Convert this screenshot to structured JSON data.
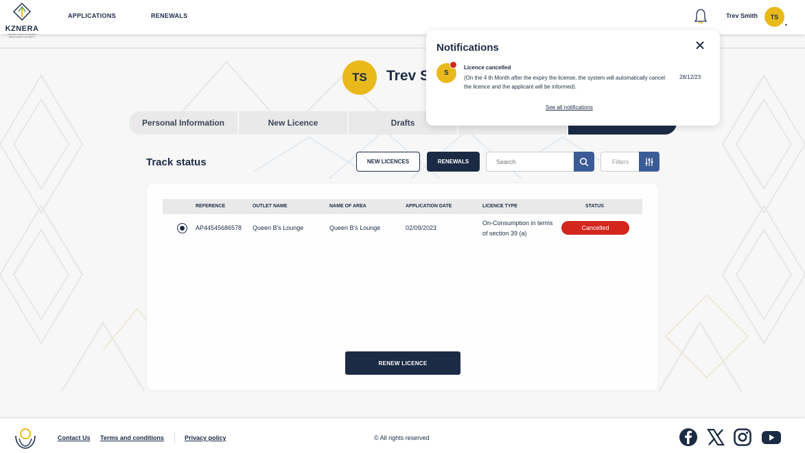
{
  "header": {
    "logo_text": "KZNERA",
    "logo_subtext": "KWAZULU-NATAL ECONOMIC REGULATORY AUTHORITY",
    "nav": [
      "APPLICATIONS",
      "RENEWALS"
    ],
    "user_name": "Trev Smith",
    "user_initials": "TS",
    "icons": {
      "notifications": "bell-icon",
      "menu": "chevron-down-icon"
    }
  },
  "profile": {
    "initials": "TS",
    "name": "Trev Smith"
  },
  "tabs": [
    {
      "label": "Personal Information"
    },
    {
      "label": "New Licence"
    },
    {
      "label": "Drafts"
    },
    {
      "label": ""
    },
    {
      "label": ""
    }
  ],
  "track": {
    "title": "Track status",
    "new_licences_label": "NEW LICENCES",
    "renewals_label": "RENEWALS",
    "search_placeholder": "Search",
    "filters_label": "Filters"
  },
  "table": {
    "headers": [
      "REFERENCE",
      "OUTLET NAME",
      "NAME OF AREA",
      "APPLICATION DATE",
      "LICENCE TYPE",
      "STATUS"
    ],
    "rows": [
      {
        "selected": true,
        "reference": "AP44545686578",
        "outlet_name": "Queen B's Lounge",
        "area": "Queen B's Lounge",
        "date": "02/09/2023",
        "licence_type_line1": "On-Consumption in terms",
        "licence_type_line2": "of section 39 (a)",
        "status": "Cancelled"
      }
    ],
    "renew_label": "RENEW LICENCE"
  },
  "notifications": {
    "title": "Notifications",
    "items": [
      {
        "initial": "S",
        "unread": true,
        "title": "Licence cancelled",
        "body": "(On the 4 th Month after the expiry the license, the system will automatically cancel the licence and the applicant will be informed).",
        "date": "28/12/23"
      }
    ],
    "see_all": "See all notifications"
  },
  "footer": {
    "links": [
      "Contact Us",
      "Terms and conditions",
      "Privacy policy"
    ],
    "copyright": "© All rights reserved",
    "social_icons": [
      "facebook-icon",
      "x-icon",
      "instagram-icon",
      "youtube-icon"
    ]
  },
  "colors": {
    "navy": "#1c2b45",
    "accent_yellow": "#e9b91b",
    "status_cancelled": "#d3261d",
    "search_blue": "#3b5b96"
  }
}
